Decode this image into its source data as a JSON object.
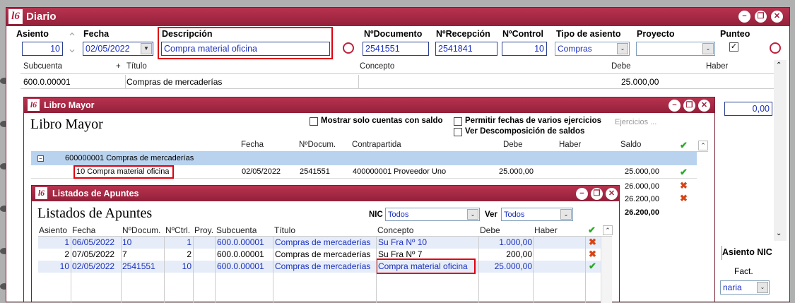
{
  "diario": {
    "title": "Diario",
    "labels": {
      "asiento": "Asiento",
      "fecha": "Fecha",
      "descripcion": "Descripción",
      "ndoc": "NºDocumento",
      "nrecep": "NºRecepción",
      "ncontrol": "NºControl",
      "tipo": "Tipo de asiento",
      "proyecto": "Proyecto",
      "punteo": "Punteo"
    },
    "values": {
      "asiento": "10",
      "fecha": "02/05/2022",
      "descripcion": "Compra material oficina",
      "ndoc": "2541551",
      "nrecep": "2541841",
      "ncontrol": "10",
      "tipo": "Compras",
      "proyecto": "",
      "punteo_mark": "✓"
    },
    "grid_headers": {
      "subcuenta": "Subcuenta",
      "plus": "+",
      "titulo": "Título",
      "concepto": "Concepto",
      "debe": "Debe",
      "haber": "Haber"
    },
    "row": {
      "subcuenta": "600.0.00001",
      "titulo": "Compras de mercaderías",
      "debe": "25.000,00"
    },
    "right_value": "0,00",
    "asiento_nic": "Asiento NIC",
    "fact": "Fact.",
    "maria": "naria"
  },
  "mayor": {
    "title": "Libro Mayor",
    "heading": "Libro Mayor",
    "checks": {
      "solo_saldo": "Mostrar solo cuentas con saldo",
      "permitir": "Permitir fechas de varios ejercicios",
      "descomp": "Ver Descomposición de saldos"
    },
    "ejercicios": "Ejercicios ...",
    "headers": {
      "fecha": "Fecha",
      "ndocum": "NºDocum.",
      "contrapartida": "Contrapartida",
      "debe": "Debe",
      "haber": "Haber",
      "saldo": "Saldo"
    },
    "group": "600000001 Compras de mercaderías",
    "row1": {
      "desc": "10  Compra material oficina",
      "fecha": "02/05/2022",
      "ndocum": "2541551",
      "contra": "400000001 Proveedor Uno",
      "debe": "25.000,00",
      "saldo": "25.000,00"
    },
    "saldos": [
      "26.000,00",
      "26.200,00",
      "26.200,00"
    ]
  },
  "listados": {
    "title": "Listados de Apuntes",
    "heading": "Listados de Apuntes",
    "nic_label": "NIC",
    "nic_value": "Todos",
    "ver_label": "Ver",
    "ver_value": "Todos",
    "headers": {
      "asiento": "Asiento",
      "fecha": "Fecha",
      "ndocum": "NºDocum.",
      "nctrl": "NºCtrl.",
      "proy": "Proy.",
      "subcuenta": "Subcuenta",
      "titulo": "Título",
      "concepto": "Concepto",
      "debe": "Debe",
      "haber": "Haber"
    },
    "rows": [
      {
        "asiento": "1",
        "fecha": "06/05/2022",
        "ndocum": "10",
        "nctrl": "1",
        "subcuenta": "600.0.00001",
        "titulo": "Compras de mercaderías",
        "concepto": "Su Fra Nº 10",
        "debe": "1.000,00"
      },
      {
        "asiento": "2",
        "fecha": "07/05/2022",
        "ndocum": "7",
        "nctrl": "2",
        "subcuenta": "600.0.00001",
        "titulo": "Compras de mercaderías",
        "concepto": "Su Fra Nº 7",
        "debe": "200,00"
      },
      {
        "asiento": "10",
        "fecha": "02/05/2022",
        "ndocum": "2541551",
        "nctrl": "10",
        "subcuenta": "600.0.00001",
        "titulo": "Compras de mercaderías",
        "concepto": "Compra material oficina",
        "debe": "25.000,00"
      }
    ]
  },
  "icons": {
    "logo": "l6",
    "minimize": "−",
    "restore": "❐",
    "close": "✕",
    "check": "✔",
    "cross": "✖"
  },
  "colors": {
    "title_bar": "#a3223e",
    "highlight_red": "#e0000f",
    "field_text": "#1a2fbf",
    "selection": "#b9d3ee"
  }
}
